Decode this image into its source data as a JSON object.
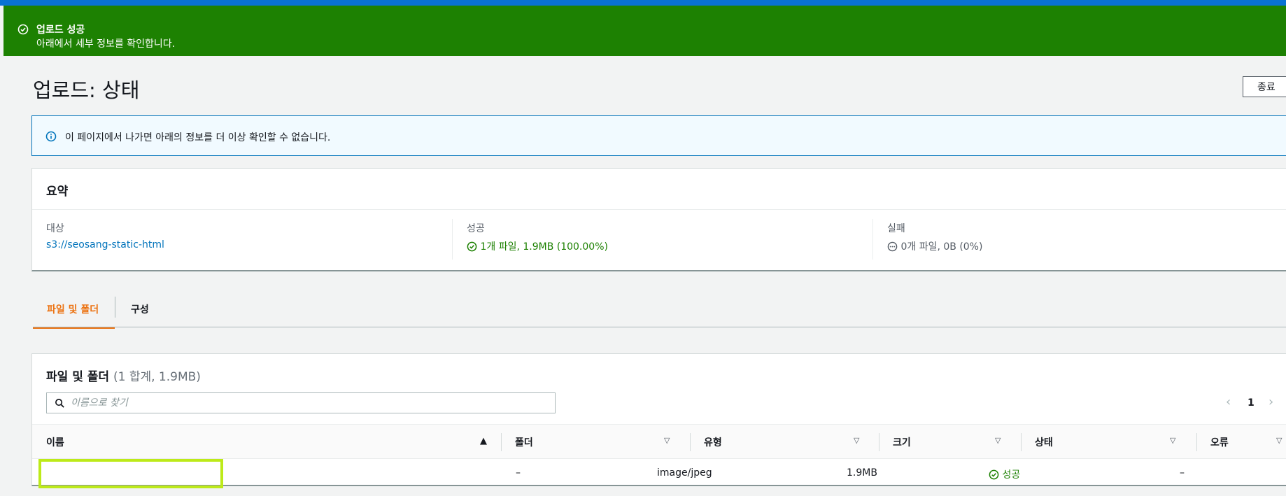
{
  "flash": {
    "icon": "check-circle-icon",
    "title": "업로드 성공",
    "message": "아래에서 세부 정보를 확인합니다.",
    "color": "#1d8102"
  },
  "header": {
    "title": "업로드: 상태",
    "close_label": "종료"
  },
  "info": {
    "icon": "info-icon",
    "text": "이 페이지에서 나가면 아래의 정보를 더 이상 확인할 수 없습니다."
  },
  "summary": {
    "title": "요약",
    "destination_label": "대상",
    "destination_value": "s3://seosang-static-html",
    "success_label": "성공",
    "success_value": "1개 파일, 1.9MB (100.00%)",
    "failed_label": "실패",
    "failed_value": "0개 파일, 0B (0%)"
  },
  "tabs": {
    "files": "파일 및 폴더",
    "config": "구성"
  },
  "files": {
    "title": "파일 및 폴더",
    "count": "(1 합계, 1.9MB)",
    "search_placeholder": "이름으로 찾기",
    "page": "1",
    "columns": [
      "이름",
      "폴더",
      "유형",
      "크기",
      "상태",
      "오류"
    ],
    "rows": [
      {
        "name": "",
        "folder": "–",
        "type": "image/jpeg",
        "size": "1.9MB",
        "status": "성공",
        "error": "–"
      }
    ]
  },
  "colors": {
    "accent_tab": "#ec7211",
    "link": "#0073bb",
    "success": "#1d8102",
    "highlight": "#bdea19"
  }
}
